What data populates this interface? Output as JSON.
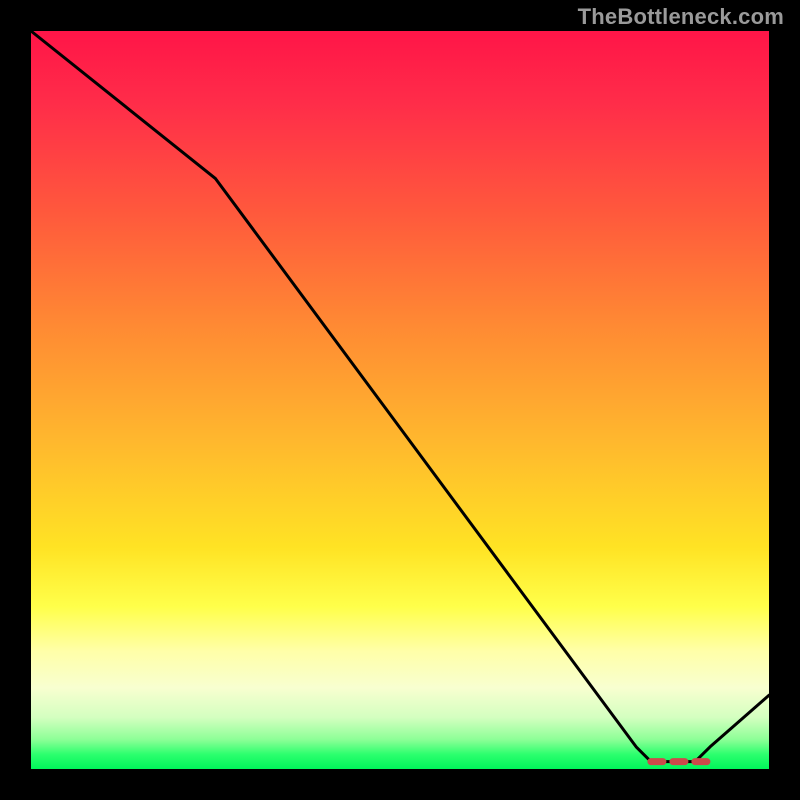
{
  "watermark": "TheBottleneck.com",
  "chart_data": {
    "type": "line",
    "title": "",
    "xlabel": "",
    "ylabel": "",
    "xlim": [
      0,
      100
    ],
    "ylim": [
      0,
      100
    ],
    "x": [
      0,
      25,
      82,
      84,
      90,
      92,
      100
    ],
    "values": [
      100,
      80,
      3,
      1,
      1,
      3,
      10
    ],
    "marker_region": {
      "x_start": 84,
      "x_end": 92,
      "style": "dashed-red-on-baseline"
    },
    "background_gradient": {
      "orientation": "vertical",
      "stops": [
        {
          "pos": 0.0,
          "color": "#ff1548"
        },
        {
          "pos": 0.25,
          "color": "#ff5a3c"
        },
        {
          "pos": 0.55,
          "color": "#ffb62e"
        },
        {
          "pos": 0.78,
          "color": "#ffff4a"
        },
        {
          "pos": 0.93,
          "color": "#d4ffc0"
        },
        {
          "pos": 1.0,
          "color": "#00f55a"
        }
      ]
    }
  }
}
